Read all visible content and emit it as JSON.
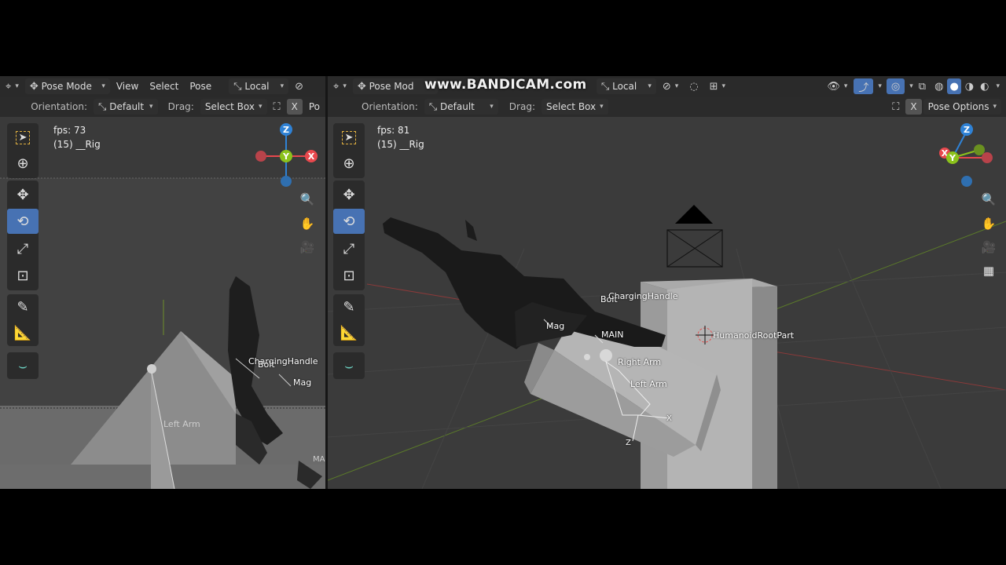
{
  "watermark": "www.BANDICAM.com",
  "left": {
    "header": {
      "mode": "Pose Mode",
      "menus": [
        "View",
        "Select",
        "Pose"
      ],
      "transform": "Local"
    },
    "subheader": {
      "orientation_label": "Orientation:",
      "orientation_value": "Default",
      "drag_label": "Drag:",
      "drag_value": "Select Box",
      "cut_text": "Po"
    },
    "stats": {
      "fps": "fps: 73",
      "object": "(15) __Rig"
    },
    "bones": {
      "charging_handle": "ChargingHandle",
      "bolt": "Bolt",
      "mag": "Mag",
      "left_arm": "Left Arm",
      "cut_label": "MA"
    }
  },
  "right": {
    "header": {
      "mode": "Pose Mod",
      "transform": "Local"
    },
    "subheader": {
      "orientation_label": "Orientation:",
      "orientation_value": "Default",
      "drag_label": "Drag:",
      "drag_value": "Select Box",
      "options": "Pose Options"
    },
    "stats": {
      "fps": "fps: 81",
      "object": "(15) __Rig"
    },
    "bones": {
      "bolt": "Bolt",
      "charging_handle": "ChargingHandle",
      "mag": "Mag",
      "main": "MAIN",
      "humanoid_root": "HumanoidRootPart",
      "right_arm": "Right Arm",
      "left_arm": "Left Arm",
      "axis_x": "X",
      "axis_z": "Z"
    }
  },
  "gizmo": {
    "x": "X",
    "y": "Y",
    "z": "Z"
  },
  "colors": {
    "accent": "#4772b3",
    "x_axis": "#e8484d",
    "y_axis": "#8bc21c",
    "z_axis": "#2f82d6"
  }
}
